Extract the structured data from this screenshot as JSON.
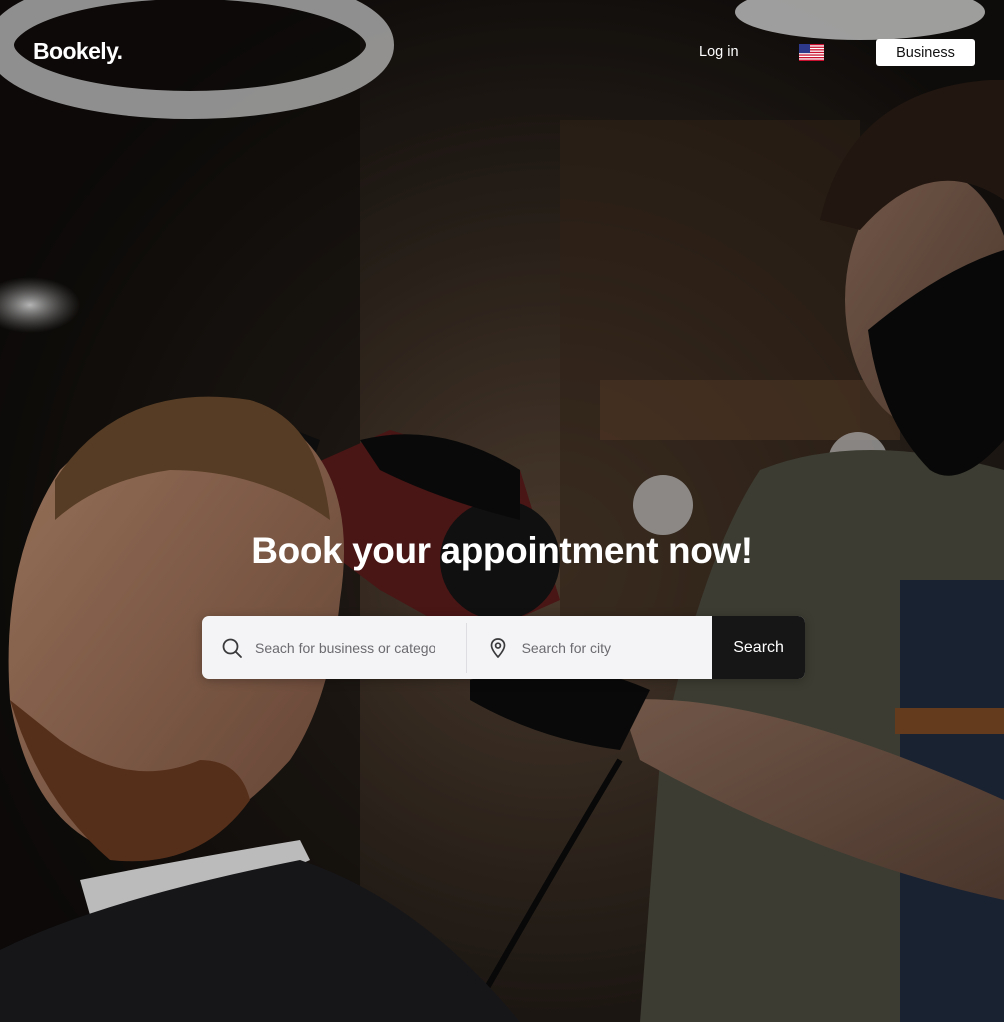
{
  "header": {
    "logo": "Bookely.",
    "login_label": "Log in",
    "language_icon": "us-flag-icon",
    "business_label": "Business"
  },
  "hero": {
    "headline": "Book your appointment now!",
    "background_image": "barber-drying-client-hair-photo"
  },
  "search": {
    "business_placeholder": "Seach for business or category",
    "business_icon": "search-icon",
    "city_placeholder": "Search for city",
    "city_icon": "map-pin-icon",
    "button_label": "Search"
  },
  "colors": {
    "search_button_bg": "#161616",
    "search_bar_bg": "#f4f4f6",
    "text_on_dark": "#ffffff",
    "business_button_bg": "#ffffff"
  }
}
